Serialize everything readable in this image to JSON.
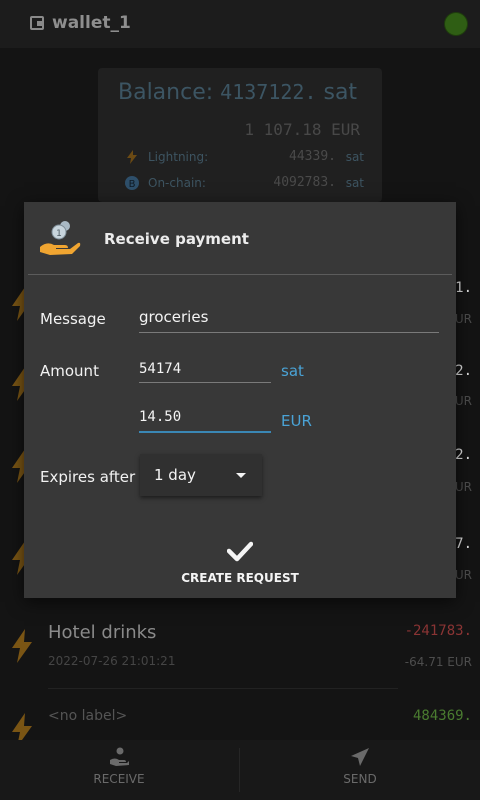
{
  "topbar": {
    "wallet_name": "wallet_1"
  },
  "balance": {
    "label": "Balance:",
    "amount": "4137122.",
    "unit": "sat",
    "fiat": "1 107.18 EUR",
    "lightning_label": "Lightning:",
    "lightning_amount": "44339.",
    "lightning_unit": "sat",
    "onchain_label": "On-chain:",
    "onchain_amount": "4092783.",
    "onchain_unit": "sat"
  },
  "history": [
    {
      "amount": "1.",
      "fiat": "UR",
      "color": "#a33b3b"
    },
    {
      "amount": "2.",
      "fiat": "UR",
      "color": "#a33b3b"
    },
    {
      "amount": "2.",
      "fiat": "UR",
      "color": "#a33b3b"
    },
    {
      "amount": "7.",
      "fiat": "UR",
      "color": "#a33b3b"
    },
    {
      "label": "Hotel drinks",
      "date": "2022-07-26 21:01:21",
      "amount": "-241783.",
      "fiat": "-64.71 EUR",
      "color": "#b24343"
    },
    {
      "label": "<no label>",
      "amount": "484369.",
      "color": "#5c9a3a"
    }
  ],
  "dialog": {
    "title": "Receive payment",
    "message_label": "Message",
    "message_value": "groceries",
    "amount_label": "Amount",
    "amount_value": "54174",
    "amount_unit": "sat",
    "fiat_value": "14.50",
    "fiat_unit": "EUR",
    "expires_label": "Expires after",
    "expires_value": "1 day",
    "create_label": "CREATE REQUEST"
  },
  "bottombar": {
    "receive_label": "RECEIVE",
    "send_label": "SEND"
  },
  "colors": {
    "accent": "#4aa3d6",
    "bolt": "#c98a1c",
    "negative": "#b24343",
    "positive": "#5c9a3a"
  }
}
